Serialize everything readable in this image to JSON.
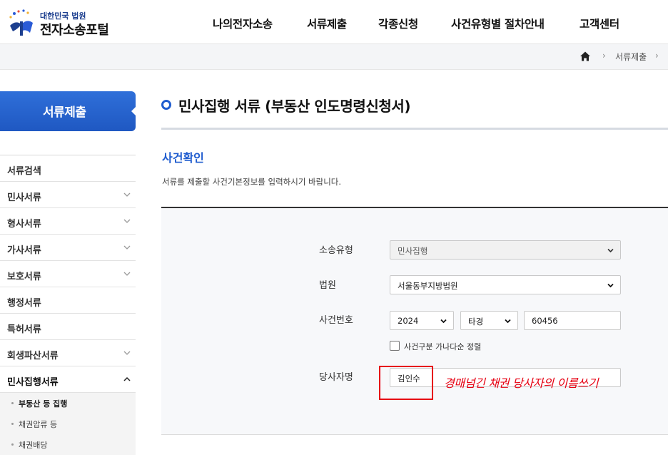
{
  "header": {
    "logo_sub": "대한민국 법원",
    "logo_main": "전자소송포털",
    "nav": [
      "나의전자소송",
      "서류제출",
      "각종신청",
      "사건유형별 절차안내",
      "고객센터"
    ]
  },
  "breadcrumb": {
    "home_icon": "home-icon",
    "current": "서류제출"
  },
  "sidebar": {
    "title": "서류제출",
    "items": [
      {
        "label": "서류검색",
        "expandable": false
      },
      {
        "label": "민사서류",
        "expandable": true
      },
      {
        "label": "형사서류",
        "expandable": true
      },
      {
        "label": "가사서류",
        "expandable": true
      },
      {
        "label": "보호서류",
        "expandable": true
      },
      {
        "label": "행정서류",
        "expandable": false
      },
      {
        "label": "특허서류",
        "expandable": false
      },
      {
        "label": "회생파산서류",
        "expandable": true
      },
      {
        "label": "민사집행서류",
        "expandable": true,
        "expanded": true
      }
    ],
    "subitems": [
      "부동산 등 집행",
      "채권압류 등",
      "채권배당"
    ]
  },
  "main": {
    "page_title": "민사집행 서류 (부동산 인도명령신청서)",
    "section_title": "사건확인",
    "section_desc": "서류를 제출할 사건기본정보를 입력하시기 바랍니다."
  },
  "form": {
    "case_type_label": "소송유형",
    "case_type_value": "민사집행",
    "court_label": "법원",
    "court_value": "서울동부지방법원",
    "case_no_label": "사건번호",
    "case_year": "2024",
    "case_code": "타경",
    "case_number": "60456",
    "sort_checkbox_label": "사건구분 가나다순 정렬",
    "party_label": "당사자명",
    "party_value": "김인수"
  },
  "annotation": {
    "text": "경매넘긴 채권 당사자의 이름쓰기",
    "color": "#e60012"
  },
  "colors": {
    "accent": "#1f5ccf",
    "sidebar_title_bg": "#2460c8"
  }
}
